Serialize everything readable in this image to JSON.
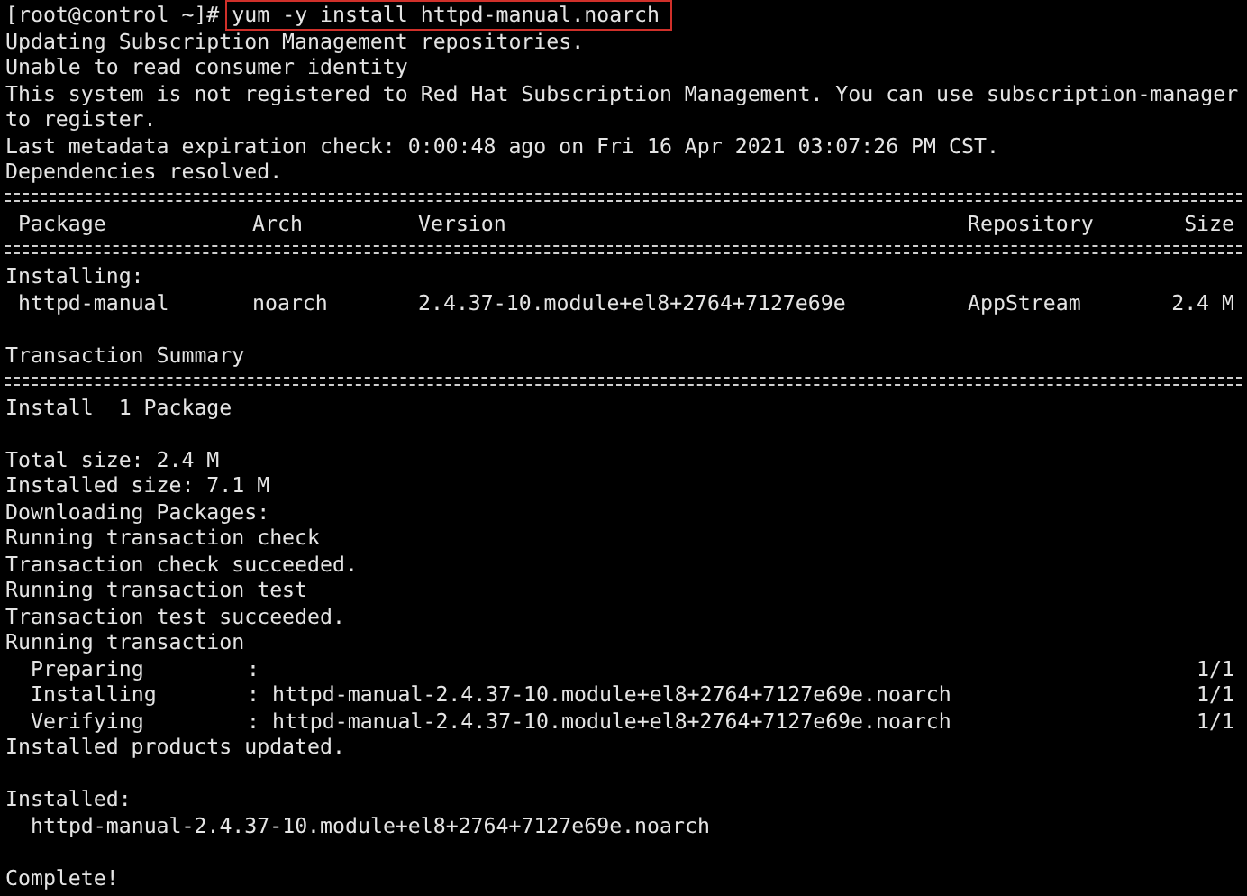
{
  "prompt": {
    "text": "[root@control ~]#",
    "command": "yum -y install httpd-manual.noarch",
    "highlighted": true
  },
  "lines": [
    {
      "kind": "text",
      "text": "Updating Subscription Management repositories."
    },
    {
      "kind": "text",
      "text": "Unable to read consumer identity"
    },
    {
      "kind": "text",
      "text": "This system is not registered to Red Hat Subscription Management. You can use subscription-manager"
    },
    {
      "kind": "text",
      "text": "to register."
    },
    {
      "kind": "text",
      "text": "Last metadata expiration check: 0:00:48 ago on Fri 16 Apr 2021 03:07:26 PM CST."
    },
    {
      "kind": "text",
      "text": "Dependencies resolved."
    },
    {
      "kind": "rule"
    },
    {
      "kind": "table_header",
      "cells": [
        "Package",
        "Arch",
        "Version",
        "Repository",
        "Size"
      ]
    },
    {
      "kind": "rule"
    },
    {
      "kind": "text",
      "text": "Installing:"
    },
    {
      "kind": "table_row",
      "cells": [
        "httpd-manual",
        "noarch",
        "2.4.37-10.module+el8+2764+7127e69e",
        "AppStream",
        "2.4 M"
      ]
    },
    {
      "kind": "blank"
    },
    {
      "kind": "text",
      "text": "Transaction Summary"
    },
    {
      "kind": "rule"
    },
    {
      "kind": "text",
      "text": "Install  1 Package"
    },
    {
      "kind": "blank"
    },
    {
      "kind": "text",
      "text": "Total size: 2.4 M"
    },
    {
      "kind": "text",
      "text": "Installed size: 7.1 M"
    },
    {
      "kind": "text",
      "text": "Downloading Packages:"
    },
    {
      "kind": "text",
      "text": "Running transaction check"
    },
    {
      "kind": "text",
      "text": "Transaction check succeeded."
    },
    {
      "kind": "text",
      "text": "Running transaction test"
    },
    {
      "kind": "text",
      "text": "Transaction test succeeded."
    },
    {
      "kind": "text",
      "text": "Running transaction"
    },
    {
      "kind": "step",
      "label": "Preparing",
      "detail": ":",
      "count": "1/1"
    },
    {
      "kind": "step",
      "label": "Installing",
      "detail": ": httpd-manual-2.4.37-10.module+el8+2764+7127e69e.noarch",
      "count": "1/1"
    },
    {
      "kind": "step",
      "label": "Verifying",
      "detail": ": httpd-manual-2.4.37-10.module+el8+2764+7127e69e.noarch",
      "count": "1/1"
    },
    {
      "kind": "text",
      "text": "Installed products updated."
    },
    {
      "kind": "blank"
    },
    {
      "kind": "text",
      "text": "Installed:"
    },
    {
      "kind": "indented",
      "text": "httpd-manual-2.4.37-10.module+el8+2764+7127e69e.noarch"
    },
    {
      "kind": "blank"
    },
    {
      "kind": "text",
      "text": "Complete!"
    }
  ]
}
